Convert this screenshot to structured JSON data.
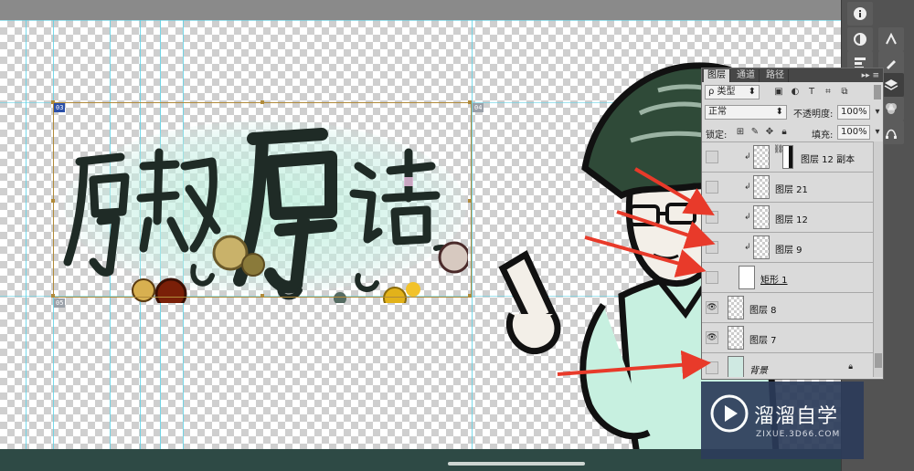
{
  "colors": {
    "guide": "#5fd2e6",
    "slice_border": "#b08a3a",
    "arrow": "#e83a2a",
    "shirt": "#c7f0e0",
    "hair": "#2f4a38",
    "watermark_bg": "#2c3c5a"
  },
  "canvas": {
    "title_art_text": "房叔房话",
    "slices": [
      {
        "label": "03"
      },
      {
        "label": "04"
      },
      {
        "label": "05"
      }
    ]
  },
  "right_tools": {
    "icons": [
      "info-icon",
      "adjust-icon",
      "paths-icon",
      "layers-icon",
      "channels-icon",
      "styles-icon"
    ]
  },
  "layers_panel": {
    "tabs": [
      "图层",
      "通道",
      "路径"
    ],
    "active_tab": "图层",
    "filter_label": "ρ 类型",
    "blend_mode": "正常",
    "opacity_label": "不透明度:",
    "opacity_value": "100%",
    "lock_label": "锁定:",
    "fill_label": "填充:",
    "fill_value": "100%",
    "layers": [
      {
        "name": "图层 12 副本",
        "visible": false,
        "clipped": true,
        "has_mask": true
      },
      {
        "name": "图层 21",
        "visible": false,
        "clipped": true,
        "has_mask": false
      },
      {
        "name": "图层 12",
        "visible": false,
        "clipped": true,
        "has_mask": false
      },
      {
        "name": "图层 9",
        "visible": false,
        "clipped": true,
        "has_mask": false
      },
      {
        "name": "矩形 1",
        "visible": false,
        "clipped": false,
        "has_mask": false
      },
      {
        "name": "图层 8",
        "visible": true,
        "clipped": false,
        "has_mask": false
      },
      {
        "name": "图层 7",
        "visible": true,
        "clipped": false,
        "has_mask": false
      },
      {
        "name": "背景",
        "visible": false,
        "clipped": false,
        "has_mask": false,
        "locked": true
      }
    ]
  },
  "watermark": {
    "title": "溜溜自学",
    "url": "ZIXUE.3D66.COM"
  }
}
